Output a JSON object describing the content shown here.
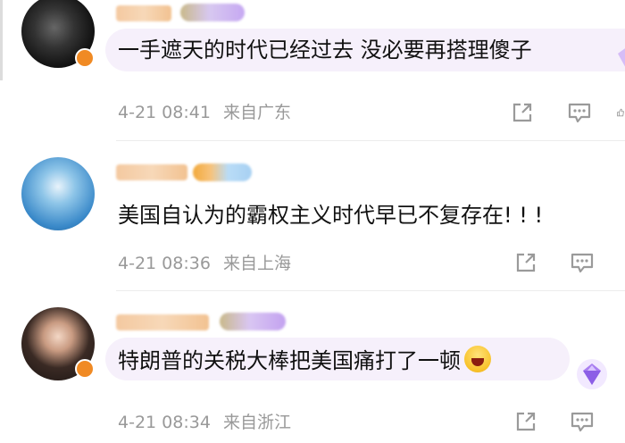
{
  "comments": [
    {
      "text": "一手遮天的时代已经过去 没必要再搭理傻子",
      "time": "4-21 08:41",
      "location": "来自广东"
    },
    {
      "text": "美国自认为的霸权主义时代早已不复存在! ! !",
      "time": "4-21 08:36",
      "location": "来自上海"
    },
    {
      "text": "特朗普的关税大棒把美国痛打了一顿",
      "time": "4-21 08:34",
      "location": "来自浙江"
    }
  ],
  "icons": {
    "share": "share-icon",
    "comment": "comment-icon",
    "emoji": "laughing-emoji-icon",
    "gem": "diamond-badge-icon"
  },
  "colors": {
    "bubble": "#f6f0fb",
    "meta_text": "#999999",
    "badge_orange": "#f08a24"
  }
}
